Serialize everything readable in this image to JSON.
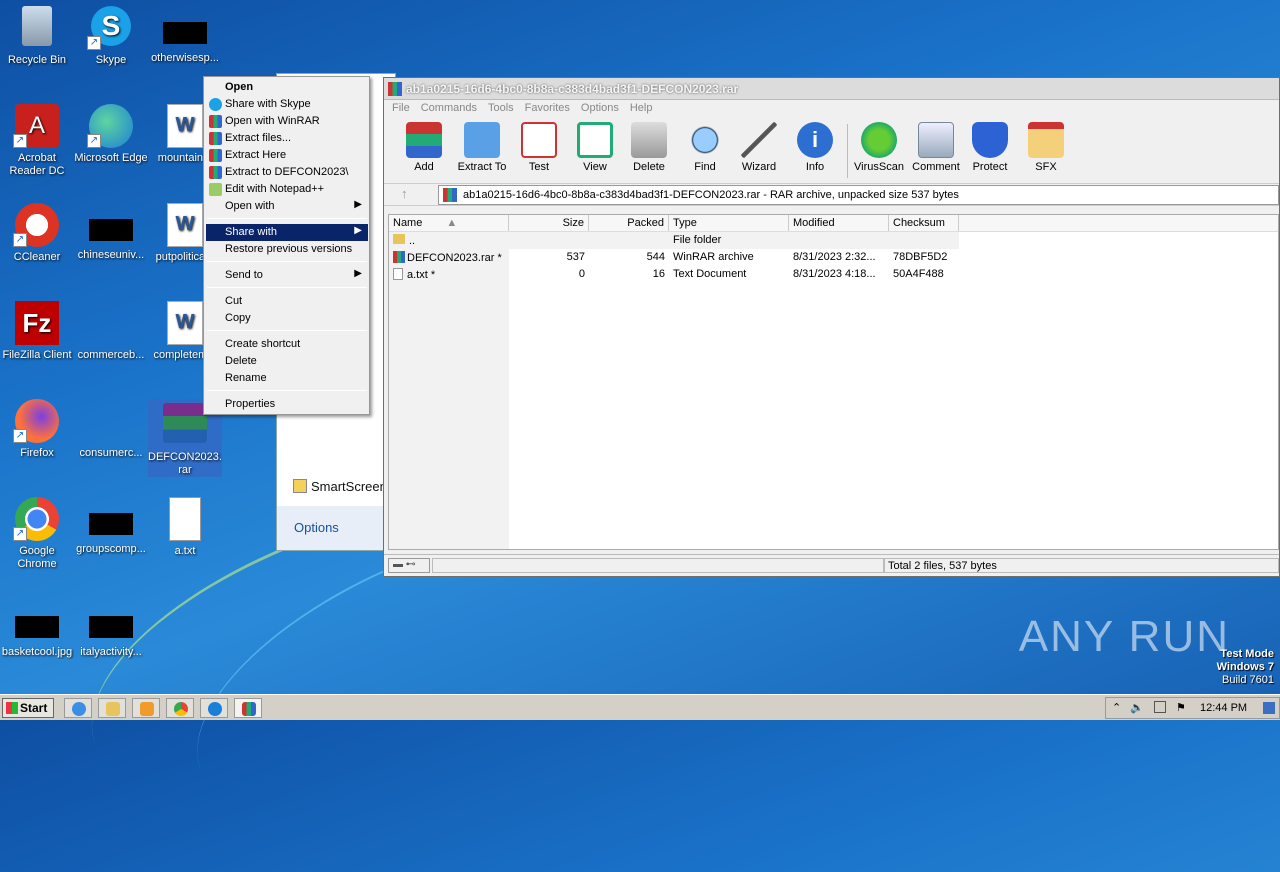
{
  "desktop": {
    "icons": [
      {
        "label": "Recycle Bin"
      },
      {
        "label": "Skype"
      },
      {
        "label": "otherwisesp..."
      },
      {
        "label": "Acrobat Reader DC"
      },
      {
        "label": "Microsoft Edge"
      },
      {
        "label": "mountain..."
      },
      {
        "label": "CCleaner"
      },
      {
        "label": "chineseuniv..."
      },
      {
        "label": "putpolitica..."
      },
      {
        "label": "FileZilla Client"
      },
      {
        "label": "commerceb..."
      },
      {
        "label": "completem..."
      },
      {
        "label": "Firefox"
      },
      {
        "label": "consumerc..."
      },
      {
        "label": "DEFCON2023.rar"
      },
      {
        "label": "Google Chrome"
      },
      {
        "label": "groupscomp..."
      },
      {
        "label": "a.txt"
      },
      {
        "label": "basketcool.jpg"
      },
      {
        "label": "italyactivity..."
      }
    ]
  },
  "bg_dialog": {
    "smartscreen": "SmartScreen",
    "options": "Options"
  },
  "winrar": {
    "title": "ab1a0215-16d6-4bc0-8b8a-c383d4bad3f1-DEFCON2023.rar",
    "menu": [
      "File",
      "Commands",
      "Tools",
      "Favorites",
      "Options",
      "Help"
    ],
    "toolbar": [
      "Add",
      "Extract To",
      "Test",
      "View",
      "Delete",
      "Find",
      "Wizard",
      "Info",
      "VirusScan",
      "Comment",
      "Protect",
      "SFX"
    ],
    "path": "ab1a0215-16d6-4bc0-8b8a-c383d4bad3f1-DEFCON2023.rar - RAR archive, unpacked size 537 bytes",
    "columns": [
      "Name",
      "Size",
      "Packed",
      "Type",
      "Modified",
      "Checksum"
    ],
    "rows": [
      {
        "name": "..",
        "size": "",
        "packed": "",
        "type": "File folder",
        "modified": "",
        "checksum": ""
      },
      {
        "name": "DEFCON2023.rar *",
        "size": "537",
        "packed": "544",
        "type": "WinRAR archive",
        "modified": "8/31/2023 2:32...",
        "checksum": "78DBF5D2"
      },
      {
        "name": "a.txt *",
        "size": "0",
        "packed": "16",
        "type": "Text Document",
        "modified": "8/31/2023 4:18...",
        "checksum": "50A4F488"
      }
    ],
    "status": "Total 2 files, 537 bytes"
  },
  "context_menu": {
    "items": [
      "Open",
      "Share with Skype",
      "Open with WinRAR",
      "Extract files...",
      "Extract Here",
      "Extract to DEFCON2023\\",
      "Edit with Notepad++",
      "Open with",
      "Share with",
      "Restore previous versions",
      "Send to",
      "Cut",
      "Copy",
      "Create shortcut",
      "Delete",
      "Rename",
      "Properties"
    ]
  },
  "taskbar": {
    "start": "Start",
    "clock": "12:44 PM"
  },
  "watermark": "ANY RUN",
  "testmode": {
    "line1": "Test Mode",
    "line2": "Windows 7",
    "line3": "Build 7601"
  }
}
